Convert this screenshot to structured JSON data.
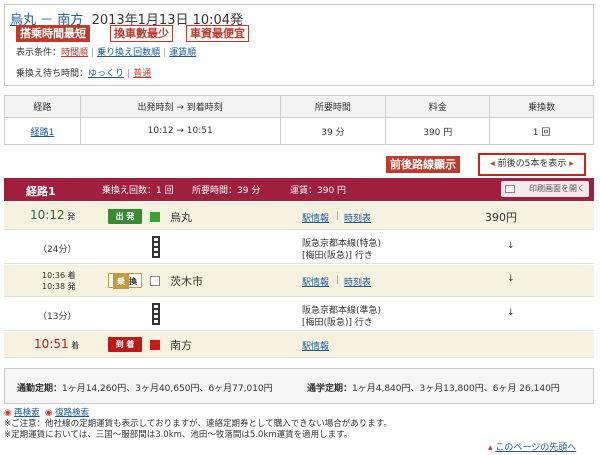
{
  "header": {
    "from": "烏丸",
    "dash": " － ",
    "to": "南方",
    "datetime": "2013年1月13日 10:04発",
    "annotations": {
      "fastest": "搭乘時間最短",
      "fewest": "換車數最少",
      "cheapest": "車資最便宜"
    },
    "conditions_label": "表示条件：",
    "conditions": [
      "時間順",
      "乗り換え回数順",
      "運賃順"
    ],
    "wait_label": "乗換え待ち時間：",
    "wait_options": [
      "ゆっくり",
      "普通"
    ]
  },
  "summary": {
    "headers": [
      "経路",
      "出発時刻 → 到着時刻",
      "所要時間",
      "料金",
      "乗換数"
    ],
    "rows": [
      {
        "route": "経路1",
        "times": "10:12 → 10:51",
        "duration": "39 分",
        "fare": "390 円",
        "transfers": "1 回"
      }
    ]
  },
  "annotation_before_after": "前後路線顯示",
  "before_after_button": "前後の5本を表示",
  "route_bar": {
    "title": "経路1",
    "transfers": "乗換え回数：1 回",
    "duration": "所要時間：39 分",
    "fare": "運賃：390 円",
    "print": "印刷画面を開く"
  },
  "stops": {
    "s1": {
      "time": "10:12",
      "suffix": "発",
      "badge": "出 発",
      "name": "烏丸",
      "info": "駅情報",
      "timetable": "時刻表",
      "fare": "390円"
    },
    "seg1": {
      "duration": "（24分）",
      "line": "阪急京都本線(特急)",
      "dest": "[梅田(阪急)] 行き",
      "arrow": "↓"
    },
    "s2": {
      "arr": "10:36 着",
      "dep": "10:38 発",
      "badge_left": "乗",
      "badge_right": "換",
      "name": "茨木市",
      "info": "駅情報",
      "timetable": "時刻表",
      "arrow": "↓"
    },
    "seg2": {
      "duration": "（13分）",
      "line": "阪急京都本線(準急)",
      "dest": "[梅田(阪急)] 行き",
      "arrow": "↓"
    },
    "s3": {
      "time": "10:51",
      "suffix": "着",
      "badge": "到 着",
      "name": "南方",
      "info": "駅情報"
    }
  },
  "pass": {
    "commute_label": "通勤定期：",
    "commute": "1ヶ月14,260円、3ヶ月40,650円、6ヶ月77,010円",
    "school_label": "通学定期：",
    "school": "1ヶ月4,840円、3ヶ月13,800円、6ヶ月 26,140円"
  },
  "links": {
    "research": "再検索",
    "return": "復路検索",
    "top": "このページの先頭へ"
  },
  "notes": [
    "※ご注意：他社線の定期運賃も表示しておりますが、連絡定期券として購入できない場合があります。",
    "※定期運賃においては、三国～服部間は3.0km、池田～牧落間は5.0km運賃を適用します。"
  ],
  "colors": {
    "route_bar": "#a01f3e",
    "annotation": "#c0392b",
    "link": "#1a5a9c"
  }
}
